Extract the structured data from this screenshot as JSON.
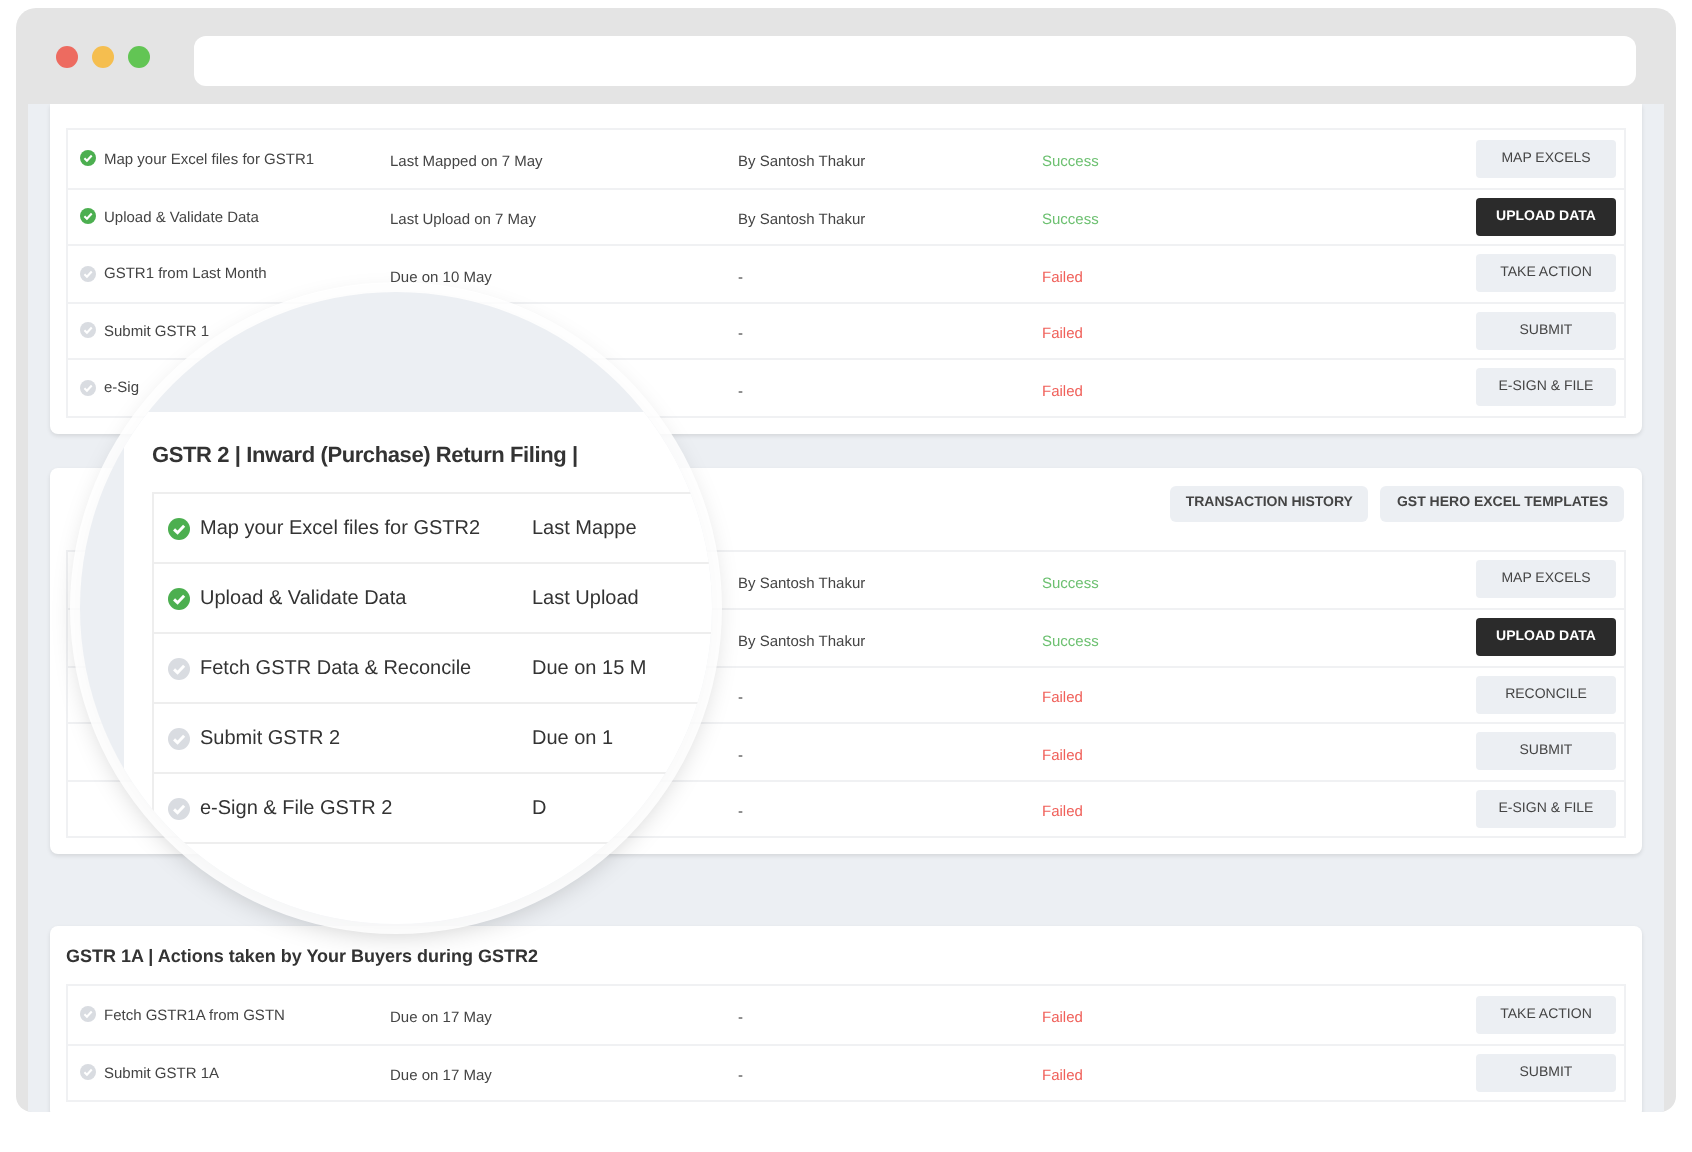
{
  "browser": {
    "dots": [
      {
        "color": "#ed6b60"
      },
      {
        "color": "#f5be4f"
      },
      {
        "color": "#62c554"
      }
    ]
  },
  "sections": [
    {
      "rows": [
        {
          "task": "Map your Excel files for GSTR1",
          "done": true,
          "date": "Last Mapped on 7 May",
          "by": "By Santosh Thakur",
          "status": "Success",
          "success": true,
          "action": "MAP EXCELS",
          "primary": false
        },
        {
          "task": "Upload & Validate Data",
          "done": true,
          "date": "Last Upload on 7 May",
          "by": "By Santosh Thakur",
          "status": "Success",
          "success": true,
          "action": "UPLOAD DATA",
          "primary": true
        },
        {
          "task": "GSTR1 from Last Month",
          "done": false,
          "date": "Due on 10 May",
          "by": "-",
          "status": "Failed",
          "success": false,
          "action": "TAKE ACTION",
          "primary": false
        },
        {
          "task": "Submit GSTR 1",
          "done": false,
          "by": "-",
          "status": "Failed",
          "success": false,
          "action": "SUBMIT",
          "primary": false
        },
        {
          "task": "e-Sig",
          "done": false,
          "by": "-",
          "status": "Failed",
          "success": false,
          "action": "E-SIGN & FILE",
          "primary": false
        }
      ]
    },
    {
      "header_buttons": [
        "TRANSACTION HISTORY",
        "GST HERO EXCEL TEMPLATES"
      ],
      "rows": [
        {
          "by": "By Santosh Thakur",
          "status": "Success",
          "success": true,
          "action": "MAP EXCELS",
          "primary": false
        },
        {
          "by": "By Santosh Thakur",
          "status": "Success",
          "success": true,
          "action": "UPLOAD DATA",
          "primary": true
        },
        {
          "by": "-",
          "status": "Failed",
          "success": false,
          "action": "RECONCILE",
          "primary": false
        },
        {
          "by": "-",
          "status": "Failed",
          "success": false,
          "action": "SUBMIT",
          "primary": false
        },
        {
          "by": "-",
          "status": "Failed",
          "success": false,
          "action": "E-SIGN & FILE",
          "primary": false
        }
      ]
    },
    {
      "title": "GSTR 1A | Actions taken by Your Buyers during GSTR2",
      "rows": [
        {
          "task": "Fetch GSTR1A from GSTN",
          "done": false,
          "date": "Due on 17 May",
          "by": "-",
          "status": "Failed",
          "success": false,
          "action": "TAKE ACTION",
          "primary": false
        },
        {
          "task": "Submit GSTR 1A",
          "done": false,
          "date": "Due on 17 May",
          "by": "-",
          "status": "Failed",
          "success": false,
          "action": "SUBMIT",
          "primary": false
        }
      ]
    }
  ],
  "magnifier": {
    "title": "GSTR 2 | Inward (Purchase) Return Filing |",
    "rows": [
      {
        "task": "Map your Excel files for GSTR2",
        "done": true,
        "date": "Last Mappe"
      },
      {
        "task": "Upload & Validate Data",
        "done": true,
        "date": "Last Upload"
      },
      {
        "task": "Fetch GSTR Data & Reconcile",
        "done": false,
        "date": "Due on 15 M"
      },
      {
        "task": "Submit GSTR 2",
        "done": false,
        "date": "Due on 1"
      },
      {
        "task": "e-Sign & File GSTR 2",
        "done": false,
        "date": "D"
      }
    ]
  }
}
